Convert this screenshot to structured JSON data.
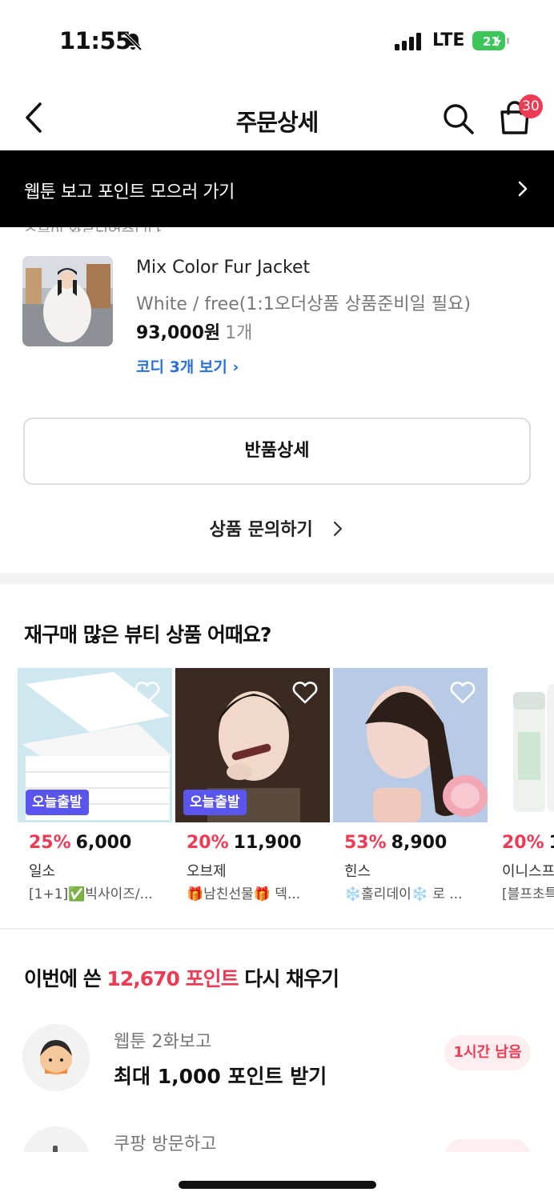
{
  "status_bar": {
    "time": "11:55",
    "network": "LTE",
    "battery": "21"
  },
  "header": {
    "title": "주문상세",
    "cart_count": "30"
  },
  "banner": {
    "text": "웹툰 보고 포인트 모으러 가기"
  },
  "peek": {
    "text": "주문이 완료되었습니다"
  },
  "product": {
    "name": "Mix Color Fur Jacket",
    "option": "White / free(1:1오더상품 상품준비일 필요)",
    "price": "93,000원",
    "qty": "1개",
    "codi_link": "코디 3개 보기 ›"
  },
  "actions": {
    "return_detail": "반품상세",
    "inquiry": "상품 문의하기"
  },
  "recommend": {
    "title": "재구매 많은 뷰티 상품 어때요?",
    "items": [
      {
        "badge": "오늘출발",
        "discount": "25%",
        "price": "6,000",
        "brand": "일소",
        "desc": "[1+1]✅빅사이즈/...",
        "colors": [
          "#cfe7ee",
          "#ffffff"
        ]
      },
      {
        "badge": "오늘출발",
        "discount": "20%",
        "price": "11,900",
        "brand": "오브제",
        "desc": "🎁남친선물🎁 덱...",
        "colors": [
          "#3a2a22",
          "#f1d8c8"
        ]
      },
      {
        "badge": "",
        "discount": "53%",
        "price": "8,900",
        "brand": "힌스",
        "desc": "❄️홀리데이❄️ 로 ...",
        "colors": [
          "#b8cbe6",
          "#f3d6cb"
        ]
      },
      {
        "badge": "",
        "discount": "20%",
        "price": "1",
        "brand": "이니스프",
        "desc": "[블프초특",
        "colors": [
          "#ffffff",
          "#e9e9e9"
        ]
      }
    ]
  },
  "points": {
    "title_prefix": "이번에 쓴 ",
    "title_highlight": "12,670 포인트",
    "title_suffix": " 다시 채우기",
    "missions": [
      {
        "sub": "웹툰 2화보고",
        "title": "최대 1,000 포인트 받기",
        "badge": "1시간 남음"
      },
      {
        "sub": "쿠팡 방문하고",
        "title": "",
        "badge": ""
      }
    ]
  }
}
